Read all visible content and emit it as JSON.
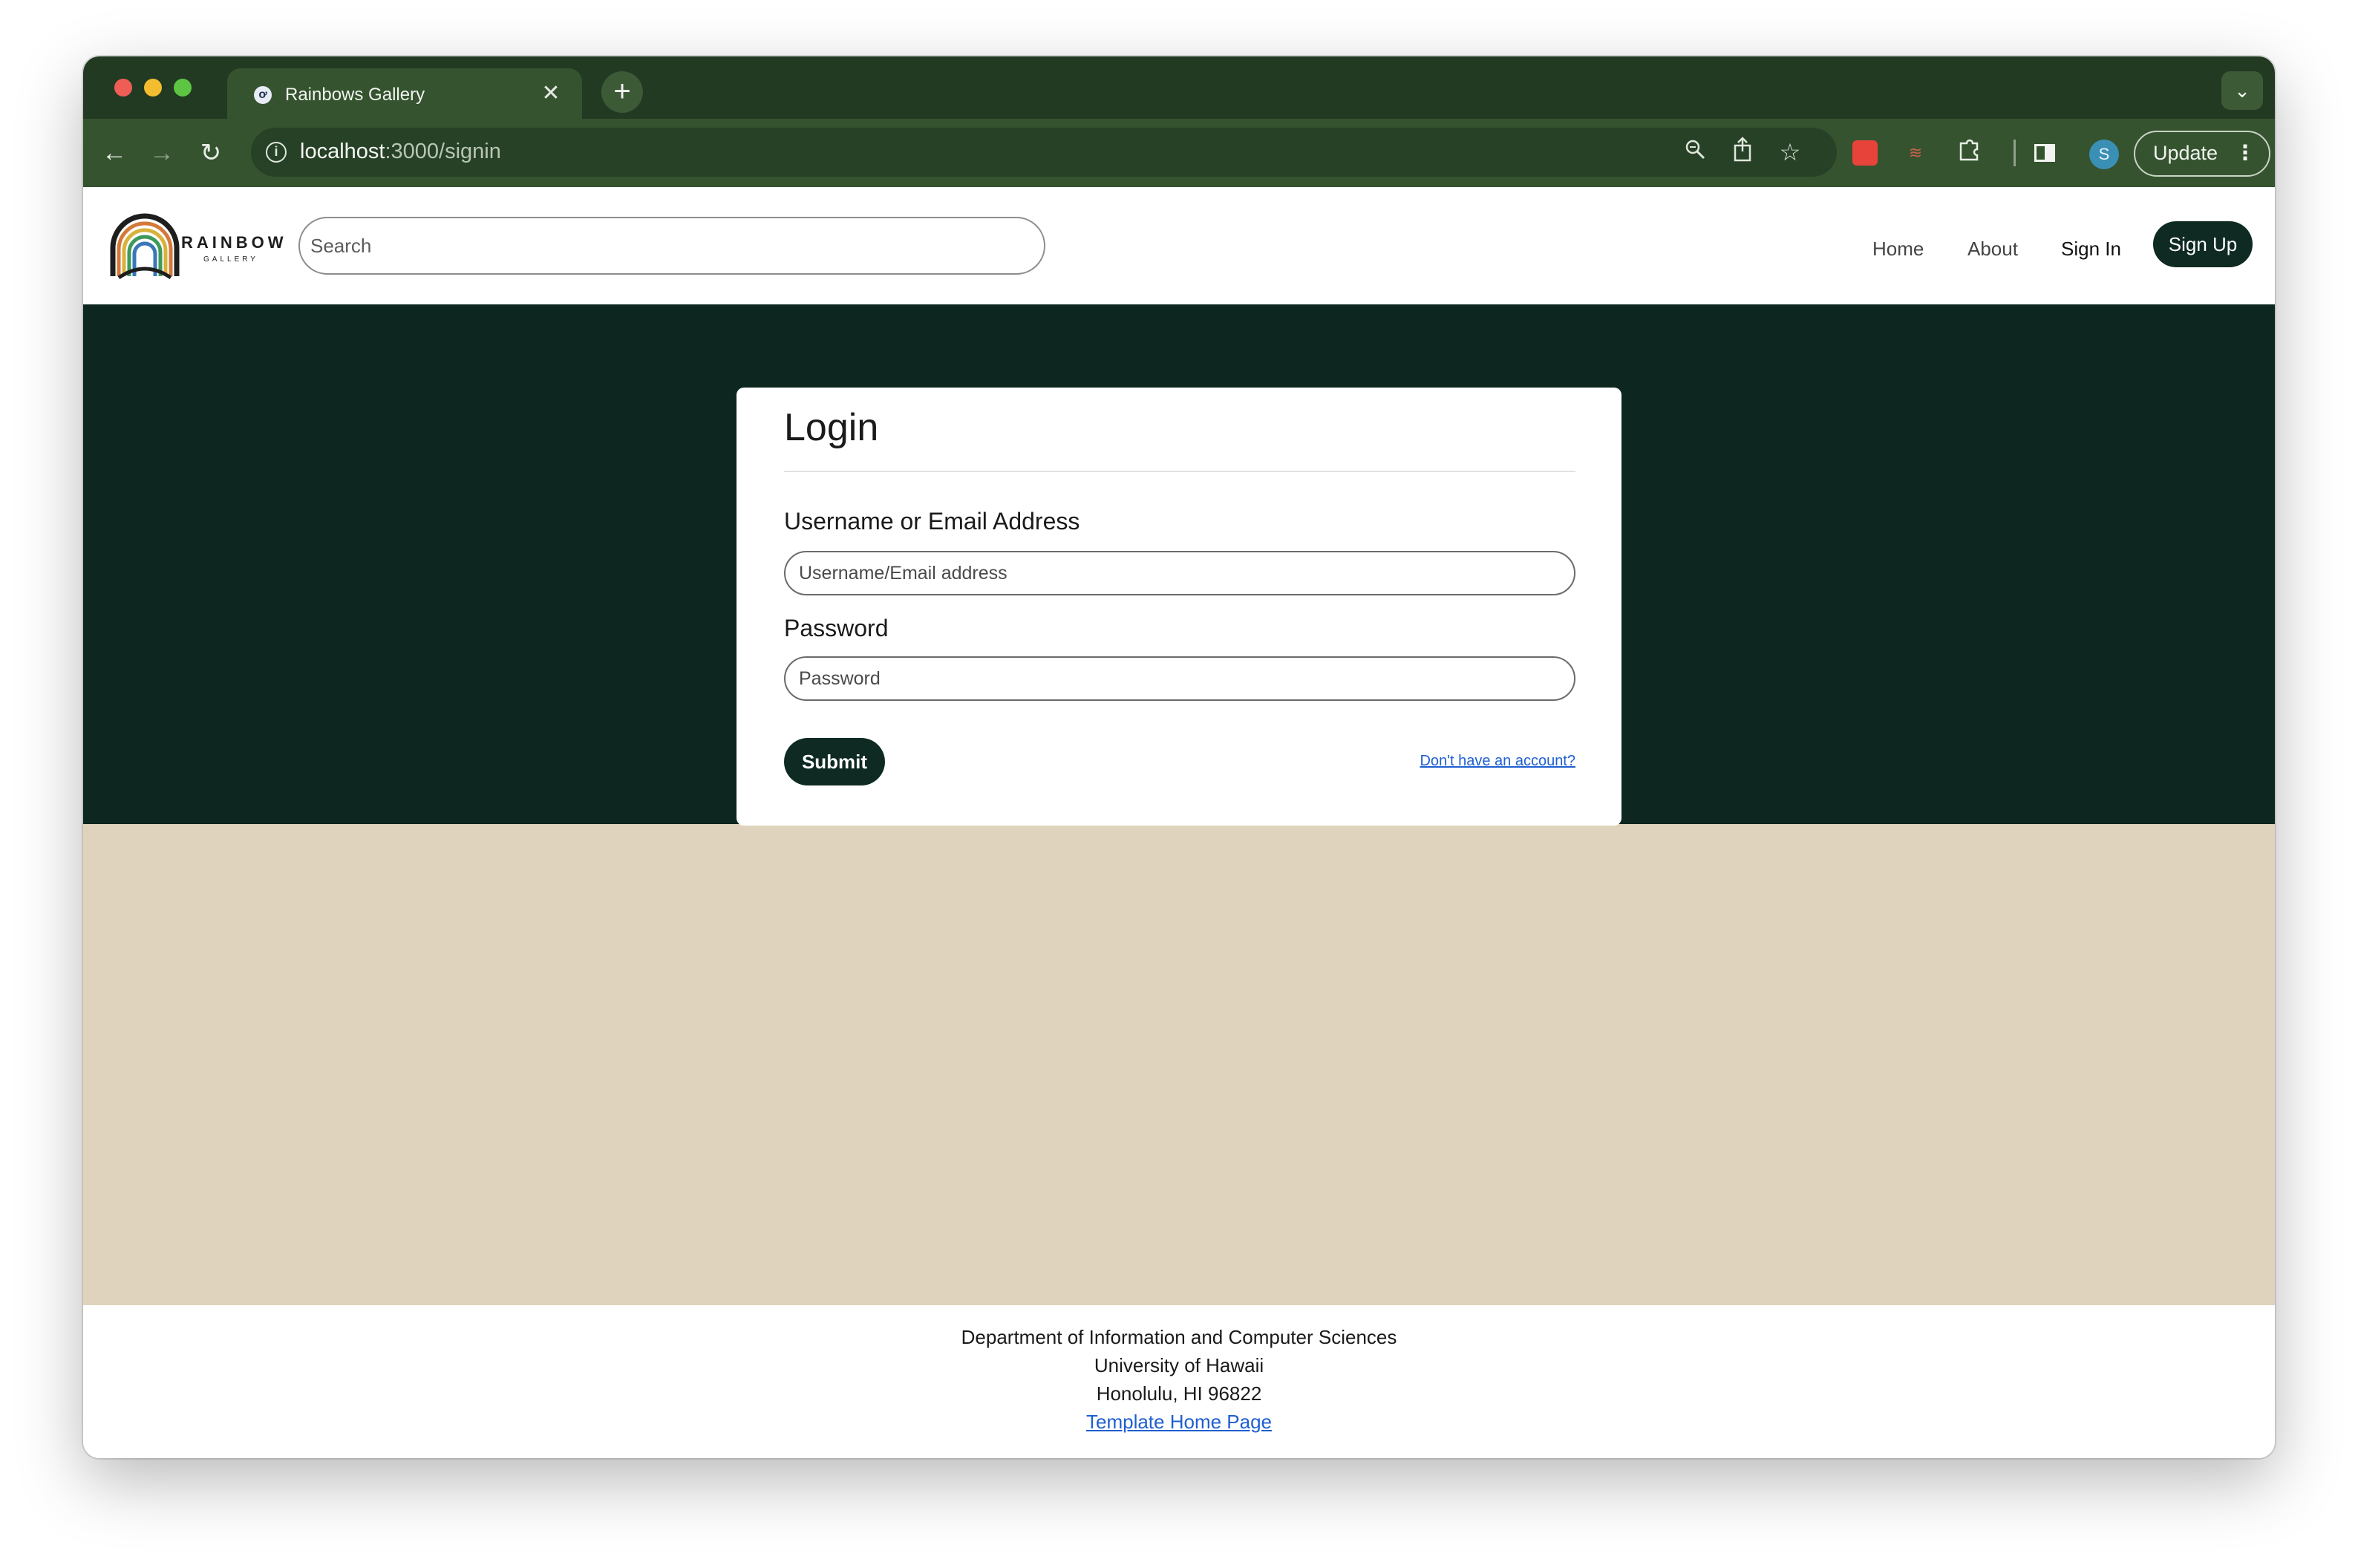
{
  "browser": {
    "tab_title": "Rainbows Gallery",
    "tab_favicon": "ơ",
    "url_host": "localhost",
    "url_path": ":3000/signin",
    "update_label": "Update",
    "profile_initial": "S"
  },
  "navbar": {
    "logo_title": "RAINBOW",
    "logo_subtitle": "GALLERY",
    "search_placeholder": "Search",
    "links": {
      "home": "Home",
      "about": "About",
      "sign_in": "Sign In",
      "sign_up": "Sign Up"
    }
  },
  "login": {
    "title": "Login",
    "username_label": "Username or Email Address",
    "username_placeholder": "Username/Email address",
    "password_label": "Password",
    "password_placeholder": "Password",
    "submit_label": "Submit",
    "no_account_link": "Don't have an account?"
  },
  "footer": {
    "line1": "Department of Information and Computer Sciences",
    "line2": "University of Hawaii",
    "line3": "Honolulu, HI 96822",
    "link": "Template Home Page"
  },
  "colors": {
    "chrome_dark": "#223a22",
    "chrome_toolbar": "#35532f",
    "hero_bg": "#0e2620",
    "tan_bg": "#e0d3bd",
    "button_dark": "#0e2a22",
    "link_blue": "#1f5fd0"
  },
  "icons": {
    "back": "back-arrow-icon",
    "forward": "forward-arrow-icon",
    "reload": "reload-icon",
    "info": "site-info-icon",
    "zoom": "zoom-icon",
    "share": "share-icon",
    "bookmark": "star-icon",
    "extensions": "puzzle-icon",
    "side_panel": "side-panel-icon"
  }
}
